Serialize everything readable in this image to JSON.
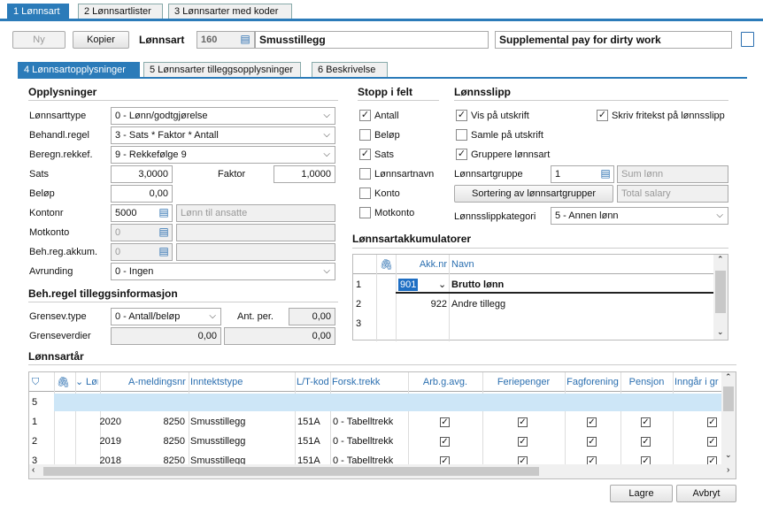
{
  "top_tabs": {
    "lonnsart": "1 Lønnsart",
    "lonnsartlister": "2 Lønnsartlister",
    "lonnsarter_koder": "3 Lønnsarter med koder"
  },
  "toolbar": {
    "ny": "Ny",
    "kopier": "Kopier",
    "lonnsart_label": "Lønnsart",
    "lonnsart_nr": "160",
    "lonnsart_navn": "Smusstillegg",
    "lonnsart_eng": "Supplemental pay for dirty work"
  },
  "sub_tabs": {
    "t4": "4 Lønnsartopplysninger",
    "t5": "5 Lønnsarter tilleggsopplysninger",
    "t6": "6 Beskrivelse"
  },
  "opplysninger": {
    "title": "Opplysninger",
    "lonnsarttype_l": "Lønnsarttype",
    "lonnsarttype_v": "0 - Lønn/godtgjørelse",
    "behandl_l": "Behandl.regel",
    "behandl_v": "3 - Sats * Faktor * Antall",
    "beregn_l": "Beregn.rekkef.",
    "beregn_v": "9 - Rekkefølge 9",
    "sats_l": "Sats",
    "sats_v": "3,0000",
    "faktor_l": "Faktor",
    "faktor_v": "1,0000",
    "belop_l": "Beløp",
    "belop_v": "0,00",
    "kontonr_l": "Kontonr",
    "kontonr_v": "5000",
    "kontonr_desc": "Lønn til ansatte",
    "motkonto_l": "Motkonto",
    "motkonto_v": "0",
    "behreg_l": "Beh.reg.akkum.",
    "behreg_v": "0",
    "avrunding_l": "Avrunding",
    "avrunding_v": "0 - Ingen"
  },
  "tillegg": {
    "title": "Beh.regel tilleggsinformasjon",
    "grensev_l": "Grensev.type",
    "grensev_v": "0 - Antall/beløp",
    "antper_l": "Ant. per.",
    "antper_v": "0,00",
    "grenseverdier_l": "Grenseverdier",
    "gv1": "0,00",
    "gv2": "0,00"
  },
  "stopp": {
    "title": "Stopp i felt",
    "items": [
      "Antall",
      "Beløp",
      "Sats",
      "Lønnsartnavn",
      "Konto",
      "Motkonto"
    ],
    "checked": [
      true,
      false,
      true,
      false,
      false,
      false
    ]
  },
  "lonnsslipp": {
    "title": "Lønnsslipp",
    "vis": "Vis på utskrift",
    "skriv": "Skriv fritekst på lønnsslipp",
    "samle": "Samle på utskrift",
    "gruppere": "Gruppere lønnsart",
    "gruppe_l": "Lønnsartgruppe",
    "gruppe_v": "1",
    "gruppe_desc": "Sum lønn",
    "sorter_btn": "Sortering av lønnsartgrupper",
    "total_desc": "Total salary",
    "kategori_l": "Lønnsslippkategori",
    "kategori_v": "5 - Annen lønn"
  },
  "akk": {
    "title": "Lønnsartakkumulatorer",
    "col_akk": "Akk.nr",
    "col_navn": "Navn",
    "rows": [
      {
        "n": "1",
        "akk": "901",
        "navn": "Brutto lønn"
      },
      {
        "n": "2",
        "akk": "922",
        "navn": "Andre tillegg"
      },
      {
        "n": "3",
        "akk": "",
        "navn": ""
      }
    ]
  },
  "aar": {
    "title": "Lønnsartår",
    "cols": [
      "Lønnsår",
      "A-meldingsnr",
      "Inntektstype",
      "L/T-kod",
      "Forsk.trekk",
      "Arb.g.avg.",
      "Feriepenger",
      "Fagforening",
      "Pensjon",
      "Inngår i gr"
    ],
    "newrow": "5",
    "rows": [
      {
        "n": "1",
        "ar": "2020",
        "am": "8250",
        "it": "Smusstillegg",
        "lt": "151A",
        "fk": "0 - Tabelltrekk"
      },
      {
        "n": "2",
        "ar": "2019",
        "am": "8250",
        "it": "Smusstillegg",
        "lt": "151A",
        "fk": "0 - Tabelltrekk"
      },
      {
        "n": "3",
        "ar": "2018",
        "am": "8250",
        "it": "Smusstillegg",
        "lt": "151A",
        "fk": "0 - Tabelltrekk"
      }
    ]
  },
  "footer": {
    "lagre": "Lagre",
    "avbryt": "Avbryt"
  }
}
